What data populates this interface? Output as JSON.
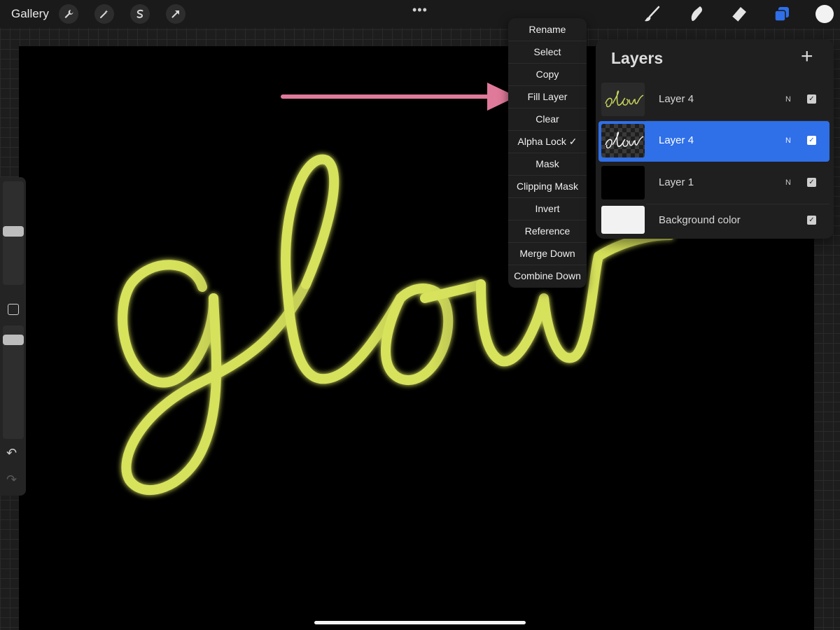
{
  "top_bar": {
    "gallery_label": "Gallery",
    "left_tools": [
      "wrench-icon",
      "magic-wand-icon",
      "selection-s-icon",
      "transform-arrow-icon"
    ],
    "right_tools": [
      "brush-icon",
      "smudge-icon",
      "eraser-icon",
      "layers-icon"
    ],
    "accent_color": "#2f6fe8",
    "current_color": "#f2f2f2"
  },
  "canvas": {
    "text": "glow",
    "stroke_color": "#d4e35a"
  },
  "context_menu": {
    "items": [
      {
        "label": "Rename"
      },
      {
        "label": "Select"
      },
      {
        "label": "Copy"
      },
      {
        "label": "Fill Layer"
      },
      {
        "label": "Clear"
      },
      {
        "label": "Alpha Lock ✓"
      },
      {
        "label": "Mask"
      },
      {
        "label": "Clipping Mask"
      },
      {
        "label": "Invert"
      },
      {
        "label": "Reference"
      },
      {
        "label": "Merge Down"
      },
      {
        "label": "Combine Down"
      }
    ]
  },
  "annotation": {
    "arrow_color": "#e07a9a"
  },
  "layers_panel": {
    "title": "Layers",
    "add_label": "+",
    "layers": [
      {
        "name": "Layer 4",
        "blend": "N",
        "visible": true,
        "selected": false
      },
      {
        "name": "Layer 4",
        "blend": "N",
        "visible": true,
        "selected": true
      },
      {
        "name": "Layer 1",
        "blend": "N",
        "visible": true,
        "selected": false
      },
      {
        "name": "Background color",
        "blend": "",
        "visible": true,
        "selected": false
      }
    ]
  }
}
